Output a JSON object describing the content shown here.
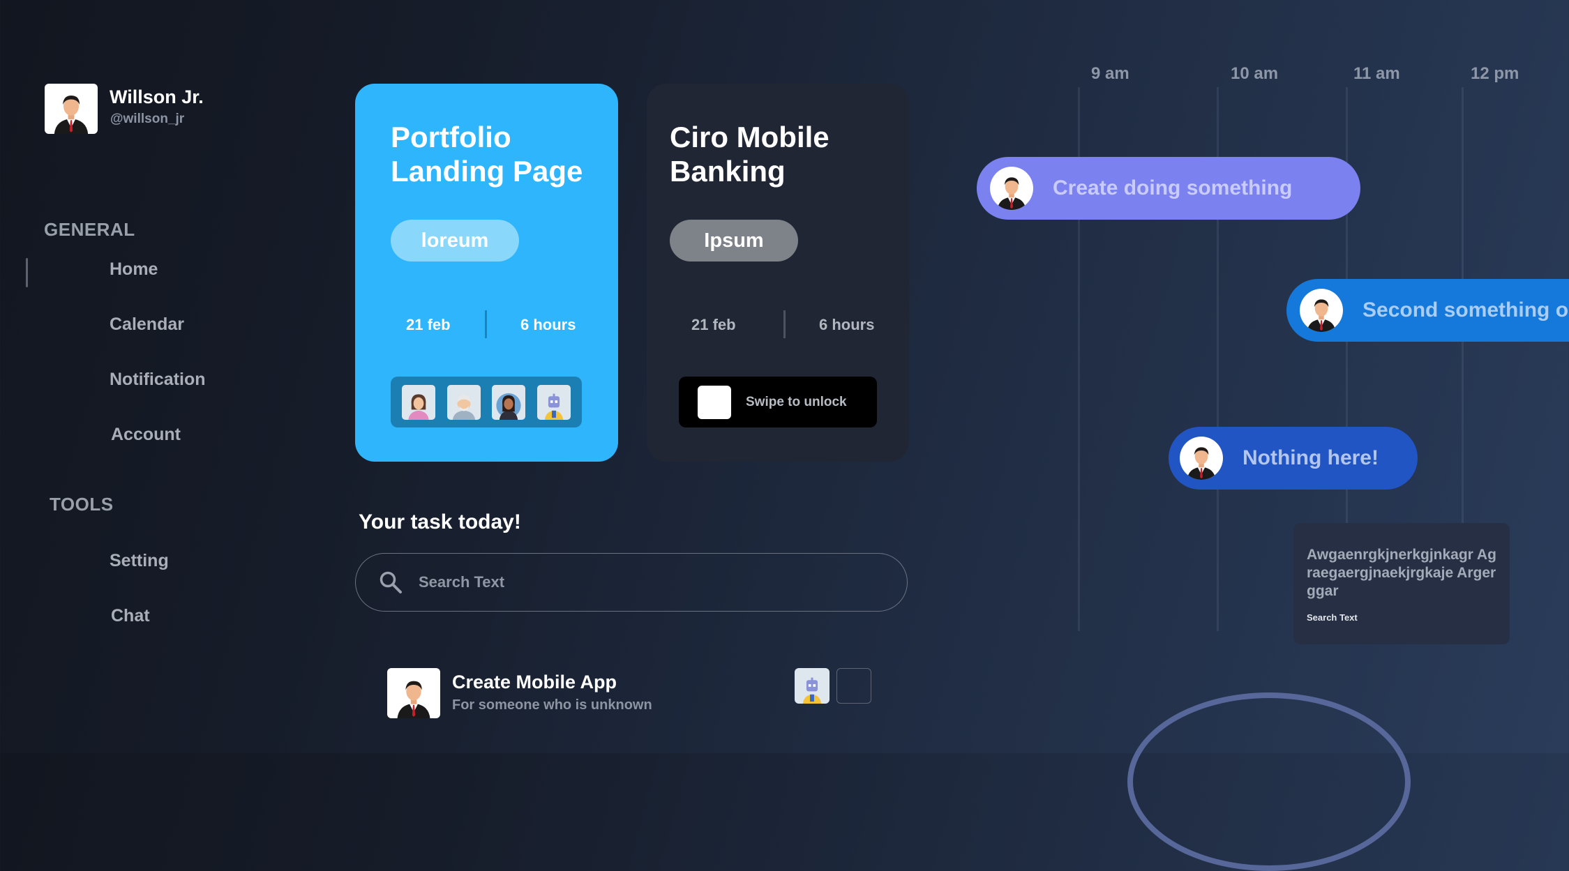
{
  "profile": {
    "name": "Willson Jr.",
    "handle": "@willson_jr"
  },
  "sidebar": {
    "general_label": "GENERAL",
    "general_items": [
      "Home",
      "Calendar",
      "Notification",
      "Account"
    ],
    "tools_label": "TOOLS",
    "tools_items": [
      "Setting",
      "Chat"
    ]
  },
  "projects": [
    {
      "title_line1": "Portfolio",
      "title_line2": "Landing Page",
      "tag": "loreum",
      "date": "21 feb",
      "duration": "6 hours",
      "accent": "#2eb5fb"
    },
    {
      "title_line1": "Ciro Mobile",
      "title_line2": "Banking",
      "tag": "Ipsum",
      "date": "21 feb",
      "duration": "6 hours",
      "swipe_label": "Swipe to unlock",
      "accent": "#202633"
    }
  ],
  "tasks": {
    "heading": "Your task today!",
    "search_placeholder": "Search Text",
    "items": [
      {
        "title": "Create Mobile App",
        "subtitle": "For someone who is unknown"
      }
    ]
  },
  "timeline": {
    "times": [
      "9 am",
      "10 am",
      "11 am",
      "12 pm"
    ],
    "events": [
      {
        "label": "Create doing something",
        "color": "#7b82f0"
      },
      {
        "label": "Second something o",
        "color": "#1479db"
      },
      {
        "label": "Nothing here!",
        "color": "#2255c4"
      }
    ],
    "note": {
      "text": "Awgaenrgkjnerkgjnkagr Agraegaergjnaekjrgkaje Argerggar",
      "sub": "Search Text"
    }
  }
}
